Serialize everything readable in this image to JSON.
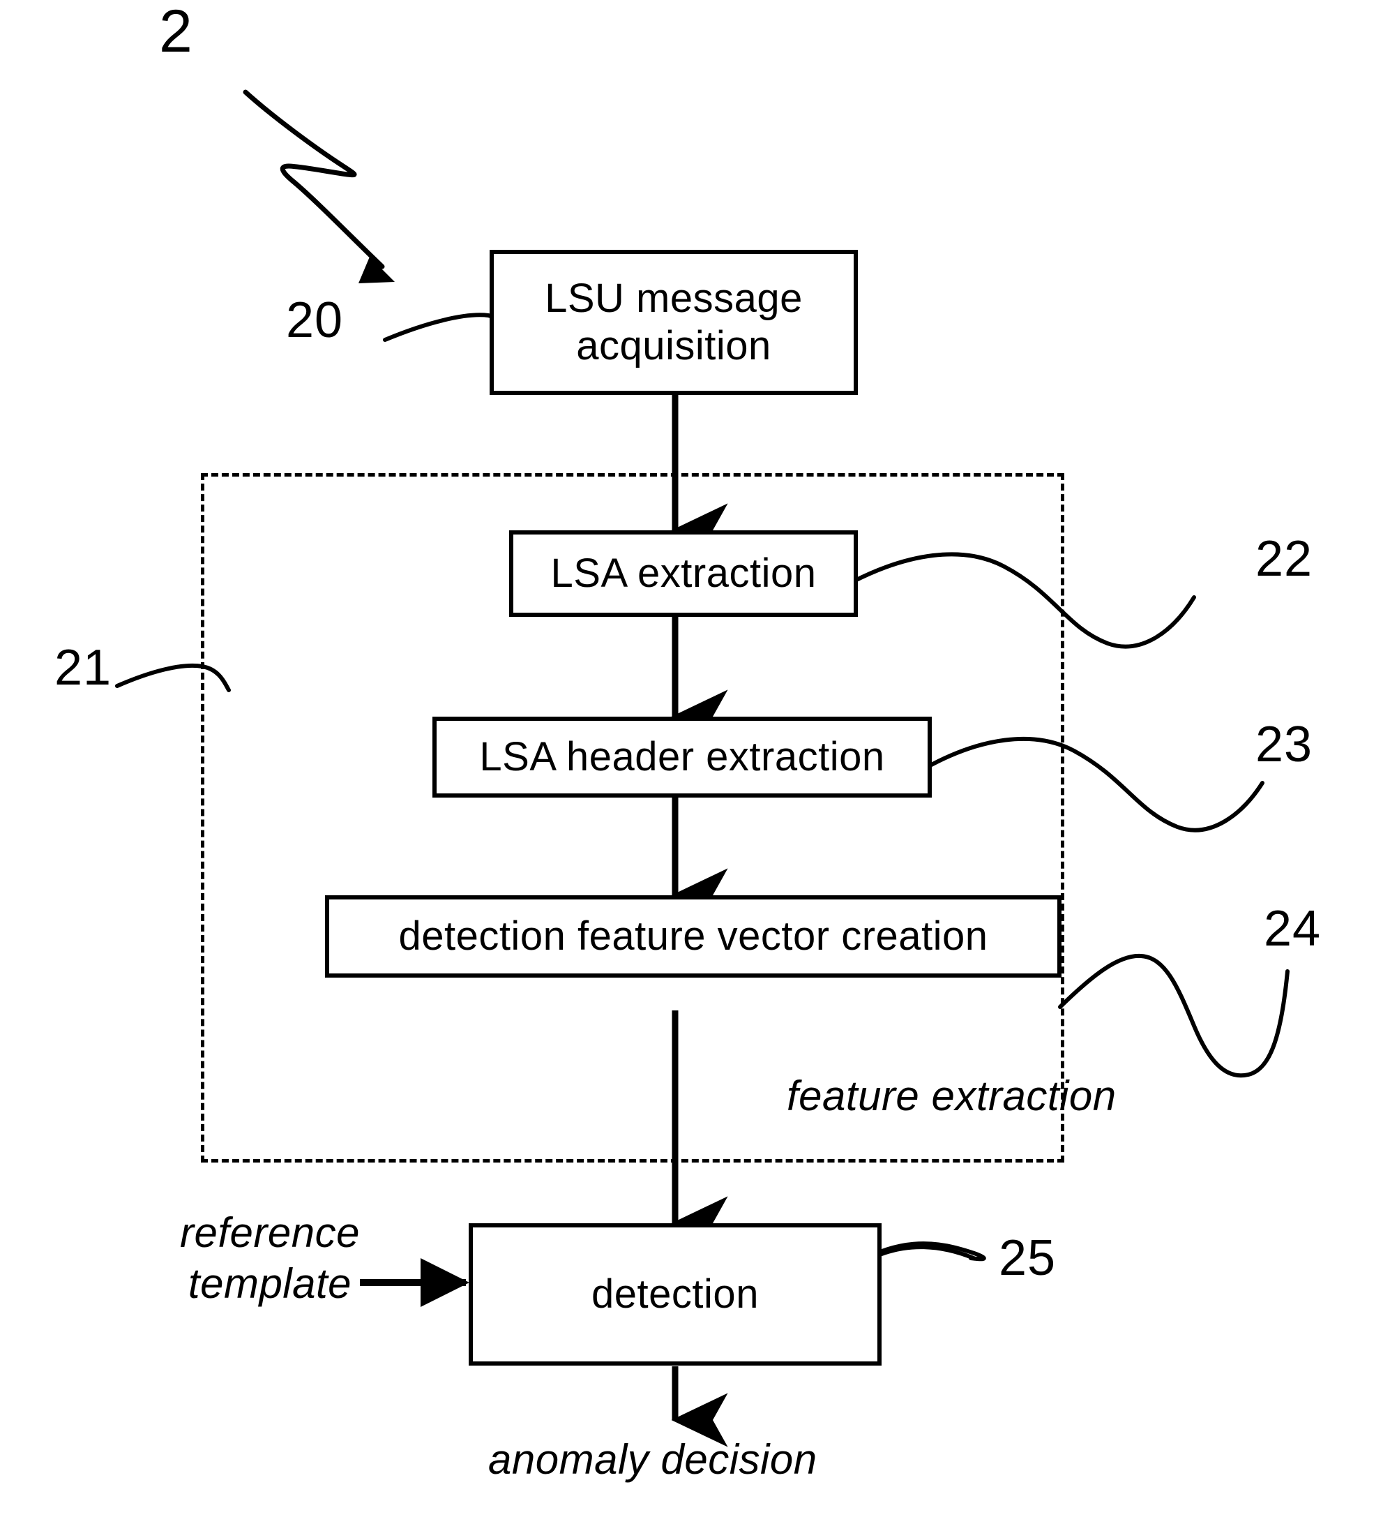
{
  "figure": {
    "figure_number": "2",
    "boxes": [
      {
        "id": "20",
        "text": "LSU message\nacquisition",
        "ref": "20"
      },
      {
        "id": "22",
        "text": "LSA extraction",
        "ref": "22"
      },
      {
        "id": "23",
        "text": "LSA header extraction",
        "ref": "23"
      },
      {
        "id": "24",
        "text": "detection feature vector creation",
        "ref": "24"
      },
      {
        "id": "25",
        "text": "detection",
        "ref": "25"
      }
    ],
    "group": {
      "ref": "21",
      "caption": "feature extraction"
    },
    "inputs": [
      {
        "name": "reference-template",
        "text": "reference\ntemplate"
      }
    ],
    "outputs": [
      {
        "name": "anomaly-decision",
        "text": "anomaly decision"
      }
    ],
    "ref_numbers": {
      "fig": "2",
      "acquisition": "20",
      "group": "21",
      "lsa_extraction": "22",
      "lsa_header_extraction": "23",
      "feature_vector_creation": "24",
      "detection": "25"
    },
    "colors": {
      "stroke": "#000000",
      "background": "#ffffff"
    }
  }
}
